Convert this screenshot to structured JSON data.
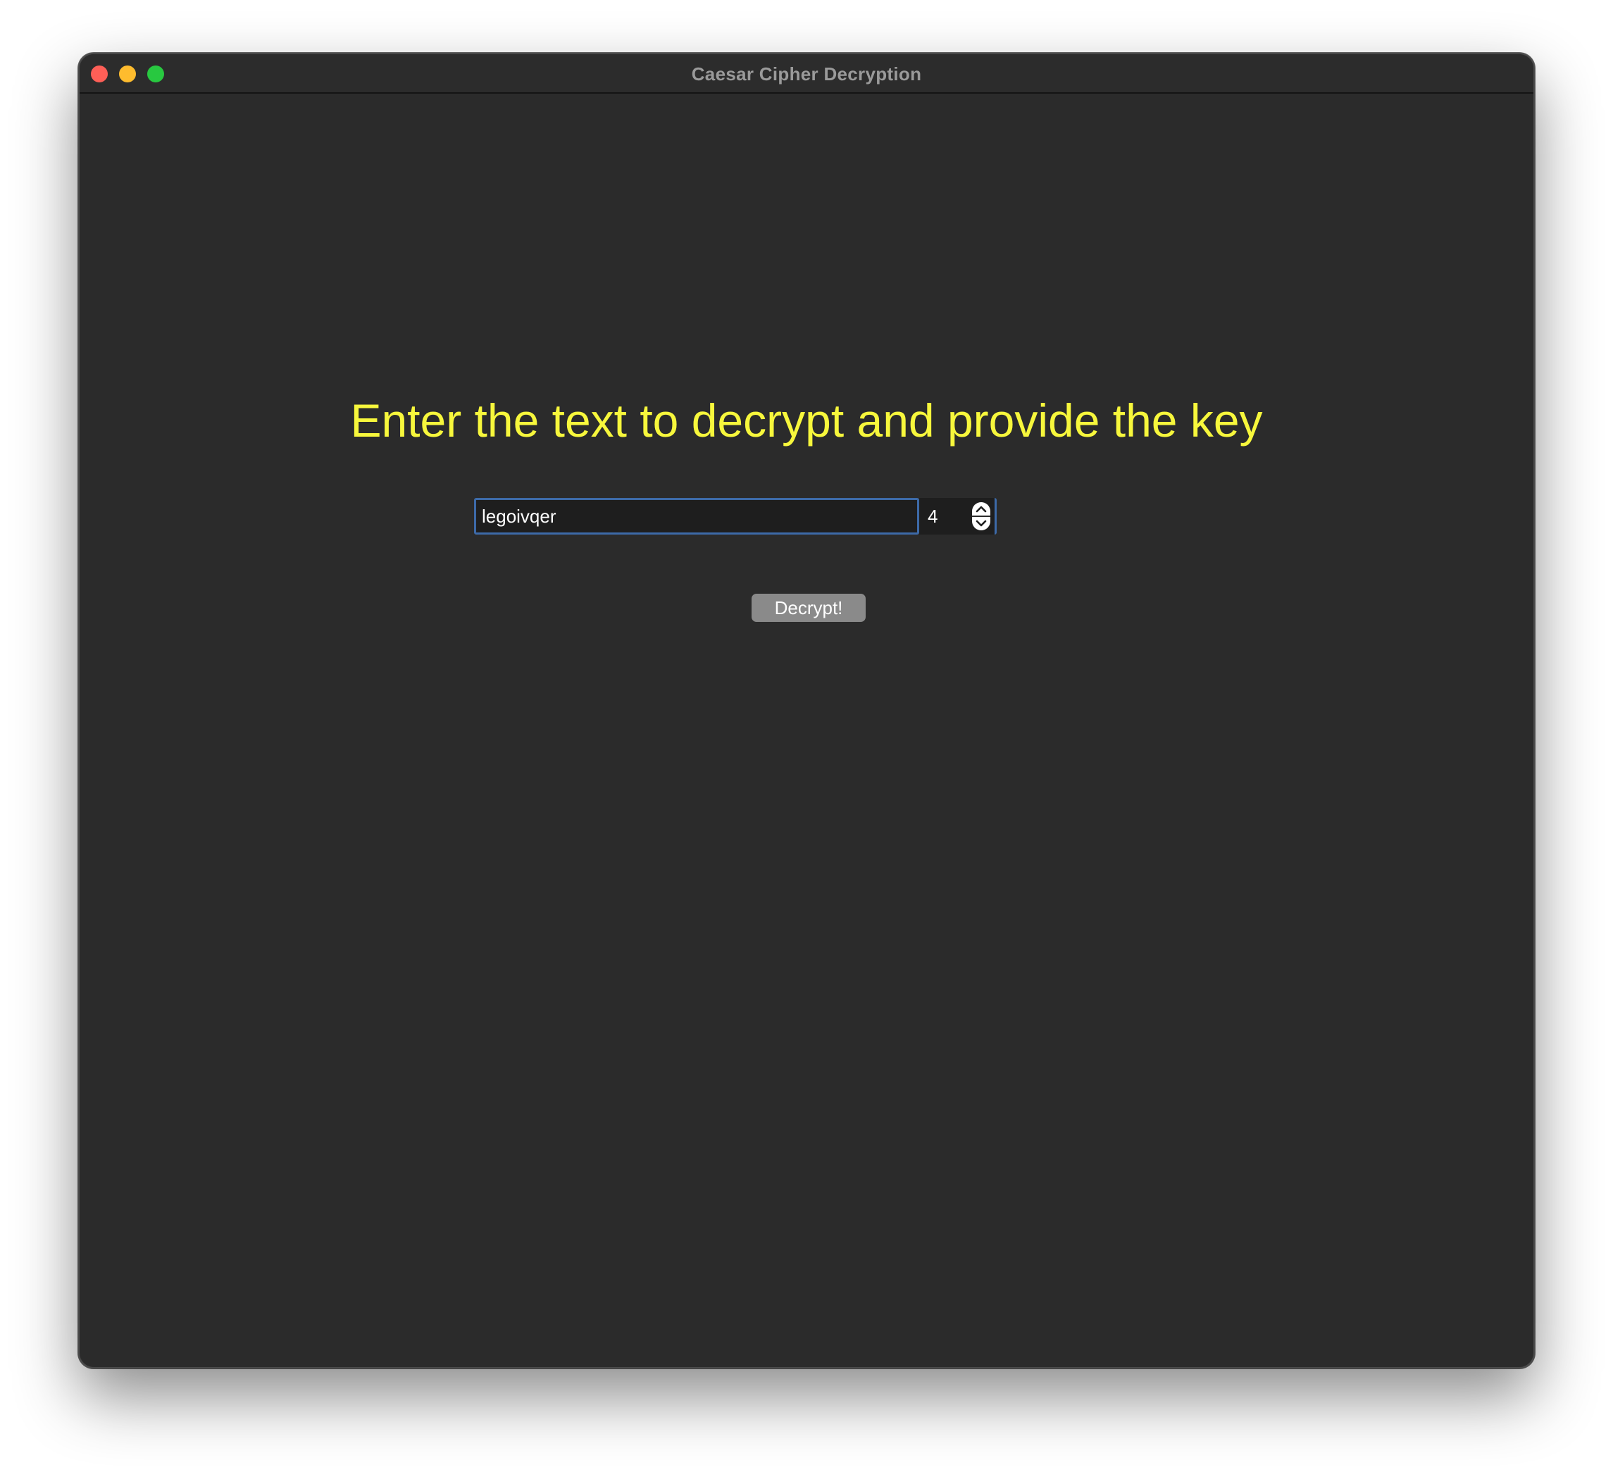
{
  "window": {
    "title": "Caesar Cipher Decryption"
  },
  "main": {
    "heading": "Enter the text to decrypt and provide the key",
    "text_input": {
      "value": "legoivqer",
      "placeholder": ""
    },
    "key_spinbox": {
      "value": "4"
    },
    "decrypt_button_label": "Decrypt!"
  },
  "colors": {
    "background": "#2b2b2b",
    "heading": "#f7f73c",
    "focus_border": "#3d6aa8",
    "button": "#8a8a8a"
  },
  "icons": {
    "close": "close-traffic-light",
    "minimize": "minimize-traffic-light",
    "zoom": "zoom-traffic-light",
    "spin_up": "chevron-up-icon",
    "spin_down": "chevron-down-icon"
  }
}
